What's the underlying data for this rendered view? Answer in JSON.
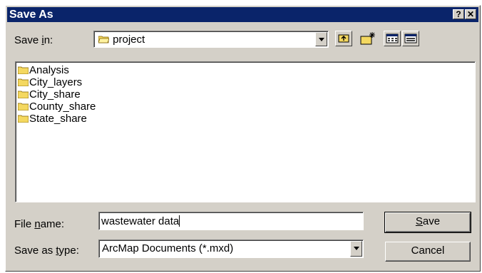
{
  "window": {
    "title": "Save As",
    "help_glyph": "?",
    "close_glyph": "✕"
  },
  "save_in": {
    "label_pre": "Save ",
    "label_accel": "i",
    "label_post": "n:",
    "value": "project",
    "toolbar": [
      "up-one-level-icon",
      "create-new-folder-icon",
      "list-view-icon",
      "details-view-icon"
    ]
  },
  "files": [
    "Analysis",
    "City_layers",
    "City_share",
    "County_share",
    "State_share"
  ],
  "file_name": {
    "label_pre": "File ",
    "label_accel": "n",
    "label_post": "ame:",
    "value": "wastewater data"
  },
  "save_as_type": {
    "label_pre": "Save as ",
    "label_accel": "t",
    "label_post": "ype:",
    "value": "ArcMap Documents (*.mxd)"
  },
  "buttons": {
    "save_accel": "S",
    "save_rest": "ave",
    "cancel": "Cancel"
  },
  "colors": {
    "titlebar": "#0a246a",
    "face": "#d4d0c8",
    "folder": "#f4d860"
  }
}
